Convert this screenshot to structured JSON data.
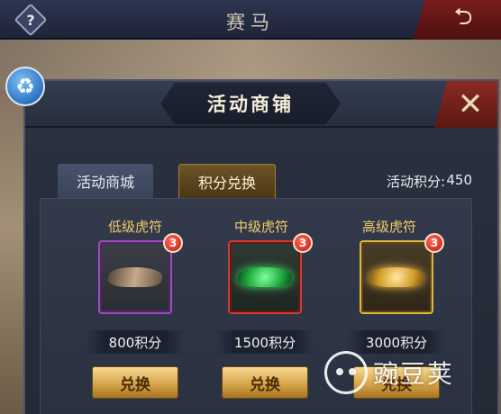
{
  "topbar": {
    "help_glyph": "?",
    "title": "赛马",
    "back_icon": "back-arrow-icon"
  },
  "recycle_icon": "recycle-icon",
  "panel": {
    "title": "活动商铺",
    "close_icon": "close-icon"
  },
  "tabs": [
    {
      "label": "活动商城",
      "active": false
    },
    {
      "label": "积分兑换",
      "active": true
    }
  ],
  "activity_points": {
    "label": "活动积分:",
    "value": "450"
  },
  "items": [
    {
      "name": "低级虎符",
      "badge": "3",
      "price": "800积分",
      "button": "兑换",
      "frame_color": "#a04bc4",
      "icon": "bronze-tiger-tally-icon"
    },
    {
      "name": "中级虎符",
      "badge": "3",
      "price": "1500积分",
      "button": "兑换",
      "frame_color": "#d03a2e",
      "icon": "jade-tiger-tally-icon"
    },
    {
      "name": "高级虎符",
      "badge": "3",
      "price": "3000积分",
      "button": "兑换",
      "frame_color": "#e0b63c",
      "icon": "gold-tiger-tally-icon"
    }
  ],
  "watermark": {
    "text": "豌豆荚"
  },
  "colors": {
    "item_name": "#f1cc6a",
    "accent_gold": "#d7a54b",
    "close_red": "#8a2a22"
  }
}
